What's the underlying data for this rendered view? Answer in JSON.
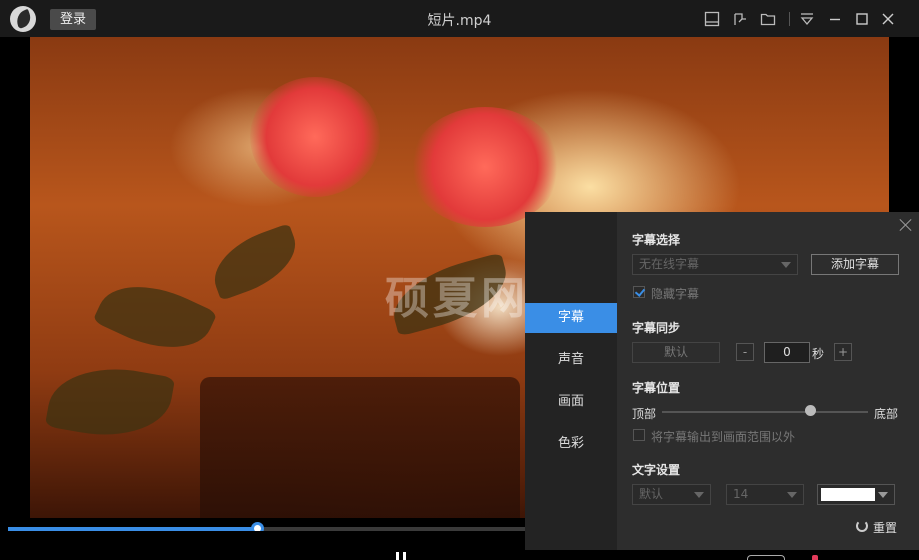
{
  "titlebar": {
    "login_label": "登录",
    "title": "短片.mp4",
    "icons": [
      "layout-icon",
      "pin-icon",
      "folder-icon",
      "menu-icon",
      "minimize-icon",
      "maximize-icon",
      "close-icon"
    ]
  },
  "video": {
    "watermark": "硕夏网",
    "progress_fraction": 0.273
  },
  "panel": {
    "nav": [
      {
        "label": "字幕",
        "active": true
      },
      {
        "label": "声音",
        "active": false
      },
      {
        "label": "画面",
        "active": false
      },
      {
        "label": "色彩",
        "active": false
      }
    ],
    "subtitle_select": {
      "title": "字幕选择",
      "dropdown_value": "无在线字幕",
      "add_button": "添加字幕",
      "hide_label": "隐藏字幕",
      "hide_checked": true
    },
    "subtitle_sync": {
      "title": "字幕同步",
      "default_button": "默认",
      "minus": "-",
      "value": "0",
      "unit": "秒",
      "plus": "+"
    },
    "subtitle_position": {
      "title": "字幕位置",
      "left_label": "顶部",
      "right_label": "底部",
      "slider_fraction": 0.72,
      "outside_label": "将字幕输出到画面范围以外",
      "outside_checked": false
    },
    "text_settings": {
      "title": "文字设置",
      "font_value": "默认",
      "size_value": "14",
      "color": "#ffffff"
    },
    "reset_label": "重置"
  },
  "colors": {
    "accent": "#3a8ee6",
    "panel_bg": "#2d2d2d"
  }
}
